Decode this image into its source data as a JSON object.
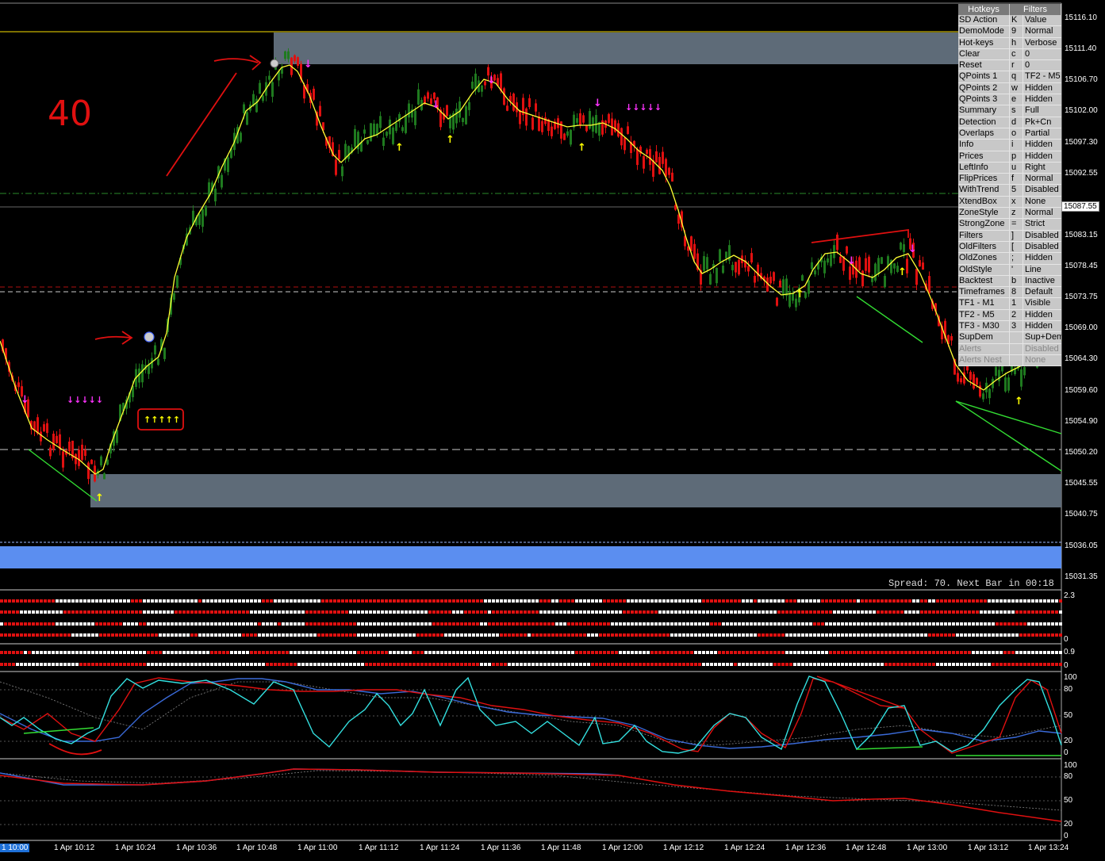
{
  "panel": {
    "headers": [
      "Hotkeys",
      "Filters"
    ],
    "rows": [
      {
        "action": "SD Action",
        "key": "K",
        "value": "Value",
        "dim": false
      },
      {
        "action": "DemoMode",
        "key": "9",
        "value": "Normal",
        "dim": false
      },
      {
        "action": "Hot-keys",
        "key": "h",
        "value": "Verbose",
        "dim": false
      },
      {
        "action": "Clear",
        "key": "c",
        "value": "0",
        "dim": false
      },
      {
        "action": "Reset",
        "key": "r",
        "value": "0",
        "dim": false
      },
      {
        "action": "QPoints 1",
        "key": "q",
        "value": "TF2 - M5",
        "dim": false
      },
      {
        "action": "QPoints 2",
        "key": "w",
        "value": "Hidden",
        "dim": false
      },
      {
        "action": "QPoints 3",
        "key": "e",
        "value": "Hidden",
        "dim": false
      },
      {
        "action": "Summary",
        "key": "s",
        "value": "Full",
        "dim": false
      },
      {
        "action": "Detection",
        "key": "d",
        "value": "Pk+Cn",
        "dim": false
      },
      {
        "action": "Overlaps",
        "key": "o",
        "value": "Partial",
        "dim": false
      },
      {
        "action": "Info",
        "key": "i",
        "value": "Hidden",
        "dim": false
      },
      {
        "action": "Prices",
        "key": "p",
        "value": "Hidden",
        "dim": false
      },
      {
        "action": "LeftInfo",
        "key": "u",
        "value": "Right",
        "dim": false
      },
      {
        "action": "FlipPrices",
        "key": "f",
        "value": "Normal",
        "dim": false
      },
      {
        "action": "WithTrend",
        "key": "5",
        "value": "Disabled",
        "dim": false
      },
      {
        "action": "XtendBox",
        "key": "x",
        "value": "None",
        "dim": false
      },
      {
        "action": "ZoneStyle",
        "key": "z",
        "value": "Normal",
        "dim": false
      },
      {
        "action": "StrongZone",
        "key": "=",
        "value": "Strict",
        "dim": false
      },
      {
        "action": "Filters",
        "key": "]",
        "value": "Disabled",
        "dim": false
      },
      {
        "action": "OldFilters",
        "key": "[",
        "value": "Disabled",
        "dim": false
      },
      {
        "action": "OldZones",
        "key": ";",
        "value": "Hidden",
        "dim": false
      },
      {
        "action": "OldStyle",
        "key": "'",
        "value": "Line",
        "dim": false
      },
      {
        "action": "Backtest",
        "key": "b",
        "value": "Inactive",
        "dim": false
      },
      {
        "action": "Timeframes",
        "key": "8",
        "value": "Default",
        "dim": false
      },
      {
        "action": "TF1 - M1",
        "key": "1",
        "value": "Visible",
        "dim": false
      },
      {
        "action": "TF2 - M5",
        "key": "2",
        "value": "Hidden",
        "dim": false
      },
      {
        "action": "TF3 - M30",
        "key": "3",
        "value": "Hidden",
        "dim": false
      },
      {
        "action": "SupDem",
        "key": "",
        "value": "Sup+Dem",
        "dim": false
      },
      {
        "action": "Alerts",
        "key": "",
        "value": "Disabled",
        "dim": true
      },
      {
        "action": "Alerts Nest",
        "key": "",
        "value": "None",
        "dim": true
      }
    ]
  },
  "price_axis": {
    "labels": [
      "15116.10",
      "15111.40",
      "15106.70",
      "15102.00",
      "15097.30",
      "15092.55",
      "15083.15",
      "15078.45",
      "15073.75",
      "15069.00",
      "15064.30",
      "15059.60",
      "15054.90",
      "15050.20",
      "15045.55",
      "15040.75",
      "15036.05",
      "15031.35"
    ],
    "current_price": "15087.55"
  },
  "time_axis": {
    "current": "1 10:00",
    "labels": [
      "1 Apr 10:12",
      "1 Apr 10:24",
      "1 Apr 10:36",
      "1 Apr 10:48",
      "1 Apr 11:00",
      "1 Apr 11:12",
      "1 Apr 11:24",
      "1 Apr 11:36",
      "1 Apr 11:48",
      "1 Apr 12:00",
      "1 Apr 12:12",
      "1 Apr 12:24",
      "1 Apr 12:36",
      "1 Apr 12:48",
      "1 Apr 13:00",
      "1 Apr 13:12",
      "1 Apr 13:24"
    ]
  },
  "status": {
    "spread_text": "Spread: 70. Next Bar in 00:18"
  },
  "indicator1": {
    "max": "2.3",
    "min": "0"
  },
  "indicator2": {
    "max": "0.9",
    "min": "0"
  },
  "oscillator1": {
    "levels": [
      "100",
      "80",
      "50",
      "20",
      "0"
    ]
  },
  "oscillator2": {
    "levels": [
      "100",
      "80",
      "50",
      "20",
      "0"
    ]
  },
  "annotation": {
    "handwritten": "40"
  },
  "colors": {
    "bull": "#1f7a1f",
    "bear": "#e01010",
    "ma": "#ffff33",
    "zone": "#5e6b78",
    "blue_band": "#5b8ef0",
    "fast_line": "#33e0e0",
    "slow_line": "#e01010",
    "trend_line": "#3a6ad8"
  }
}
